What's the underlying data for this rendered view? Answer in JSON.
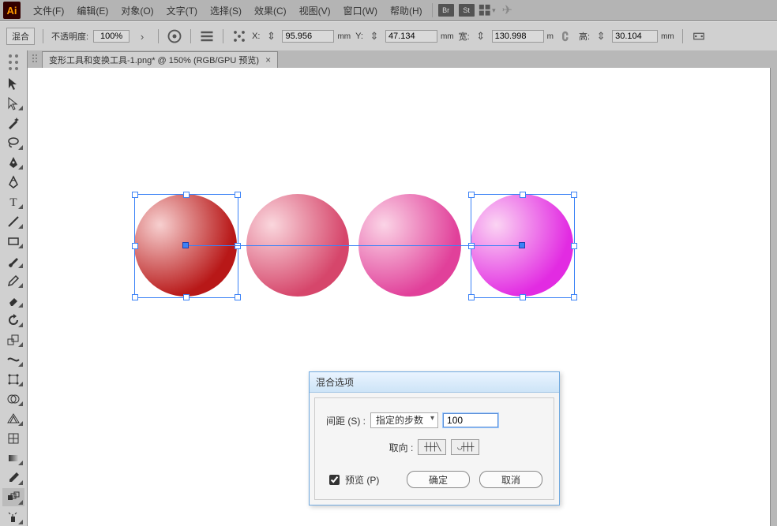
{
  "app": {
    "logo": "Ai"
  },
  "menu": [
    "文件(F)",
    "编辑(E)",
    "对象(O)",
    "文字(T)",
    "选择(S)",
    "效果(C)",
    "视图(V)",
    "窗口(W)",
    "帮助(H)"
  ],
  "badges": [
    "Br",
    "St"
  ],
  "options": {
    "mode": "混合",
    "opacity_label": "不透明度:",
    "opacity_value": "100%",
    "x_label": "X:",
    "x_value": "95.956",
    "x_unit": "mm",
    "y_label": "Y:",
    "y_value": "47.134",
    "y_unit": "mm",
    "w_label": "宽:",
    "w_value": "130.998",
    "w_unit": "m",
    "h_label": "高:",
    "h_value": "30.104",
    "h_unit": "mm"
  },
  "tab": {
    "title": "变形工具和变换工具-1.png* @ 150% (RGB/GPU 预览)"
  },
  "dialog": {
    "title": "混合选项",
    "spacing_label": "间距 (S) :",
    "spacing_value": "指定的步数",
    "steps_value": "100",
    "orient_label": "取向 :",
    "preview_label": "预览 (P)",
    "ok": "确定",
    "cancel": "取消"
  }
}
